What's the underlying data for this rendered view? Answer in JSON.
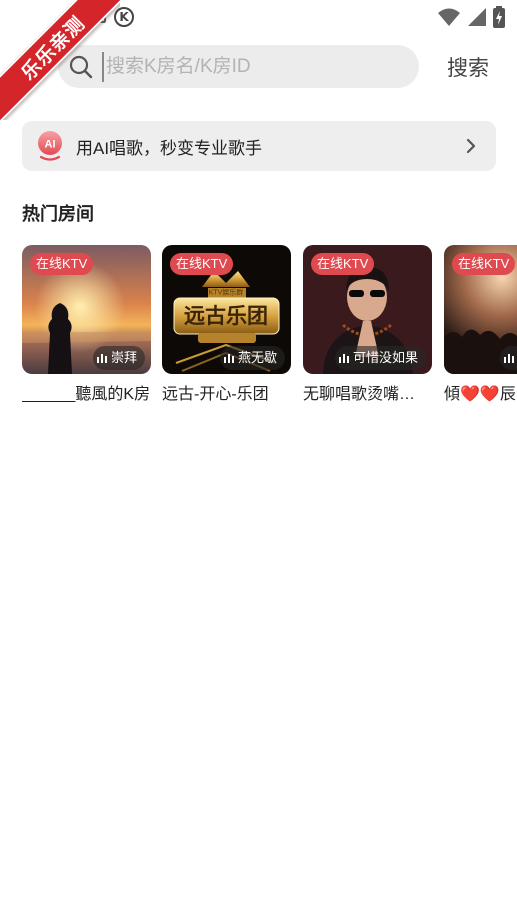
{
  "ribbon": {
    "text": "乐乐亲测"
  },
  "search": {
    "placeholder": "搜索K房名/K房ID",
    "value": "",
    "button_label": "搜索"
  },
  "ai_banner": {
    "icon_text": "AI",
    "text": "用AI唱歌，秒变专业歌手"
  },
  "hot_rooms": {
    "title": "热门房间",
    "rooms": [
      {
        "tag": "在线KTV",
        "song": "崇拜",
        "name": "______聽風的K房"
      },
      {
        "tag": "在线KTV",
        "song": "燕无歇",
        "name": "远古-开心-乐团",
        "art_title": "远古乐团",
        "art_subtitle": "KTV娱乐群"
      },
      {
        "tag": "在线KTV",
        "song": "可惜没如果",
        "name": "无聊唱歌烫嘴…"
      },
      {
        "tag": "在线KTV",
        "song": "",
        "name": "傾❤️❤️辰"
      }
    ]
  },
  "colors": {
    "accent": "#de4a4f",
    "ribbon": "#d4262a",
    "search_bg": "#ececec",
    "banner_bg": "#eeeeef"
  },
  "icons": [
    "back-icon",
    "search-icon",
    "ai-icon",
    "chevron-right-icon",
    "bars-icon",
    "signal-icon",
    "wifi-icon",
    "battery-icon"
  ]
}
